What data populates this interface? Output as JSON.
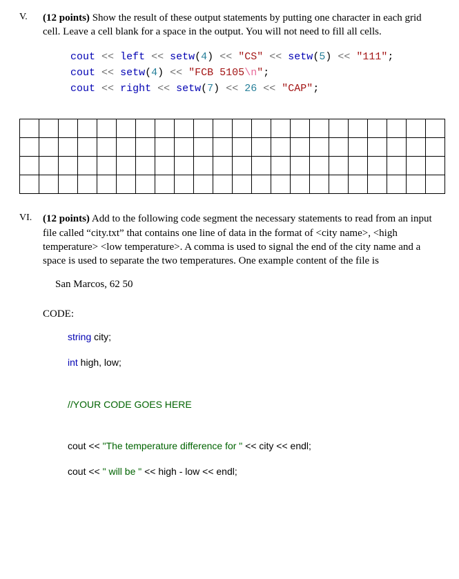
{
  "q5": {
    "number": "V.",
    "points": "(12 points)",
    "text_a": " Show the result of these output statements by putting one character in each grid cell. Leave a cell blank for a space in the output. You will not need to fill all cells.",
    "code": {
      "l1": {
        "cout": "cout",
        "op1": "<<",
        "left": "left",
        "op2": "<<",
        "setw1": "setw",
        "p1": "(",
        "a1": "4",
        "p1c": ")",
        "op3": "<<",
        "s1": "\"CS\"",
        "op4": "<<",
        "setw2": "setw",
        "p2": "(",
        "a2": "5",
        "p2c": ")",
        "op5": "<<",
        "s2": "\"111\"",
        "semi": ";"
      },
      "l2": {
        "cout": "cout",
        "op1": "<<",
        "setw": "setw",
        "p": "(",
        "a": "4",
        "pc": ")",
        "op2": "<<",
        "s_a": "\"FCB 5105",
        "esc": "\\n",
        "s_b": "\"",
        "semi": ";"
      },
      "l3": {
        "cout": "cout",
        "op1": "<<",
        "right": "right",
        "op2": "<<",
        "setw": "setw",
        "p": "(",
        "a": "7",
        "pc": ")",
        "op3": "<<",
        "n": "26",
        "op4": "<<",
        "s": "\"CAP\"",
        "semi": ";"
      }
    },
    "grid_rows": 4,
    "grid_cols": 22
  },
  "q6": {
    "number": "VI.",
    "points": "(12 points)",
    "text": " Add to the following code segment the necessary statements to read from an input file called “city.txt” that contains one line of data in the format of <city name>, <high temperature> <low temperature>. A comma is used to signal the end of the city name and a space is used to separate the two temperatures. One example content of the file is",
    "sample": "San Marcos, 62 50",
    "code_label": "CODE:",
    "decl1_kw": "string",
    "decl1_rest": " city;",
    "decl2_kw": "int",
    "decl2_rest": " high, low;",
    "placeholder": "//YOUR CODE GOES HERE",
    "out1_a": "cout << ",
    "out1_str": "\"The temperature difference for \"",
    "out1_b": " << city << endl;",
    "out2_a": "cout << ",
    "out2_str": "\" will be \"",
    "out2_b": " << high - low << endl;"
  }
}
